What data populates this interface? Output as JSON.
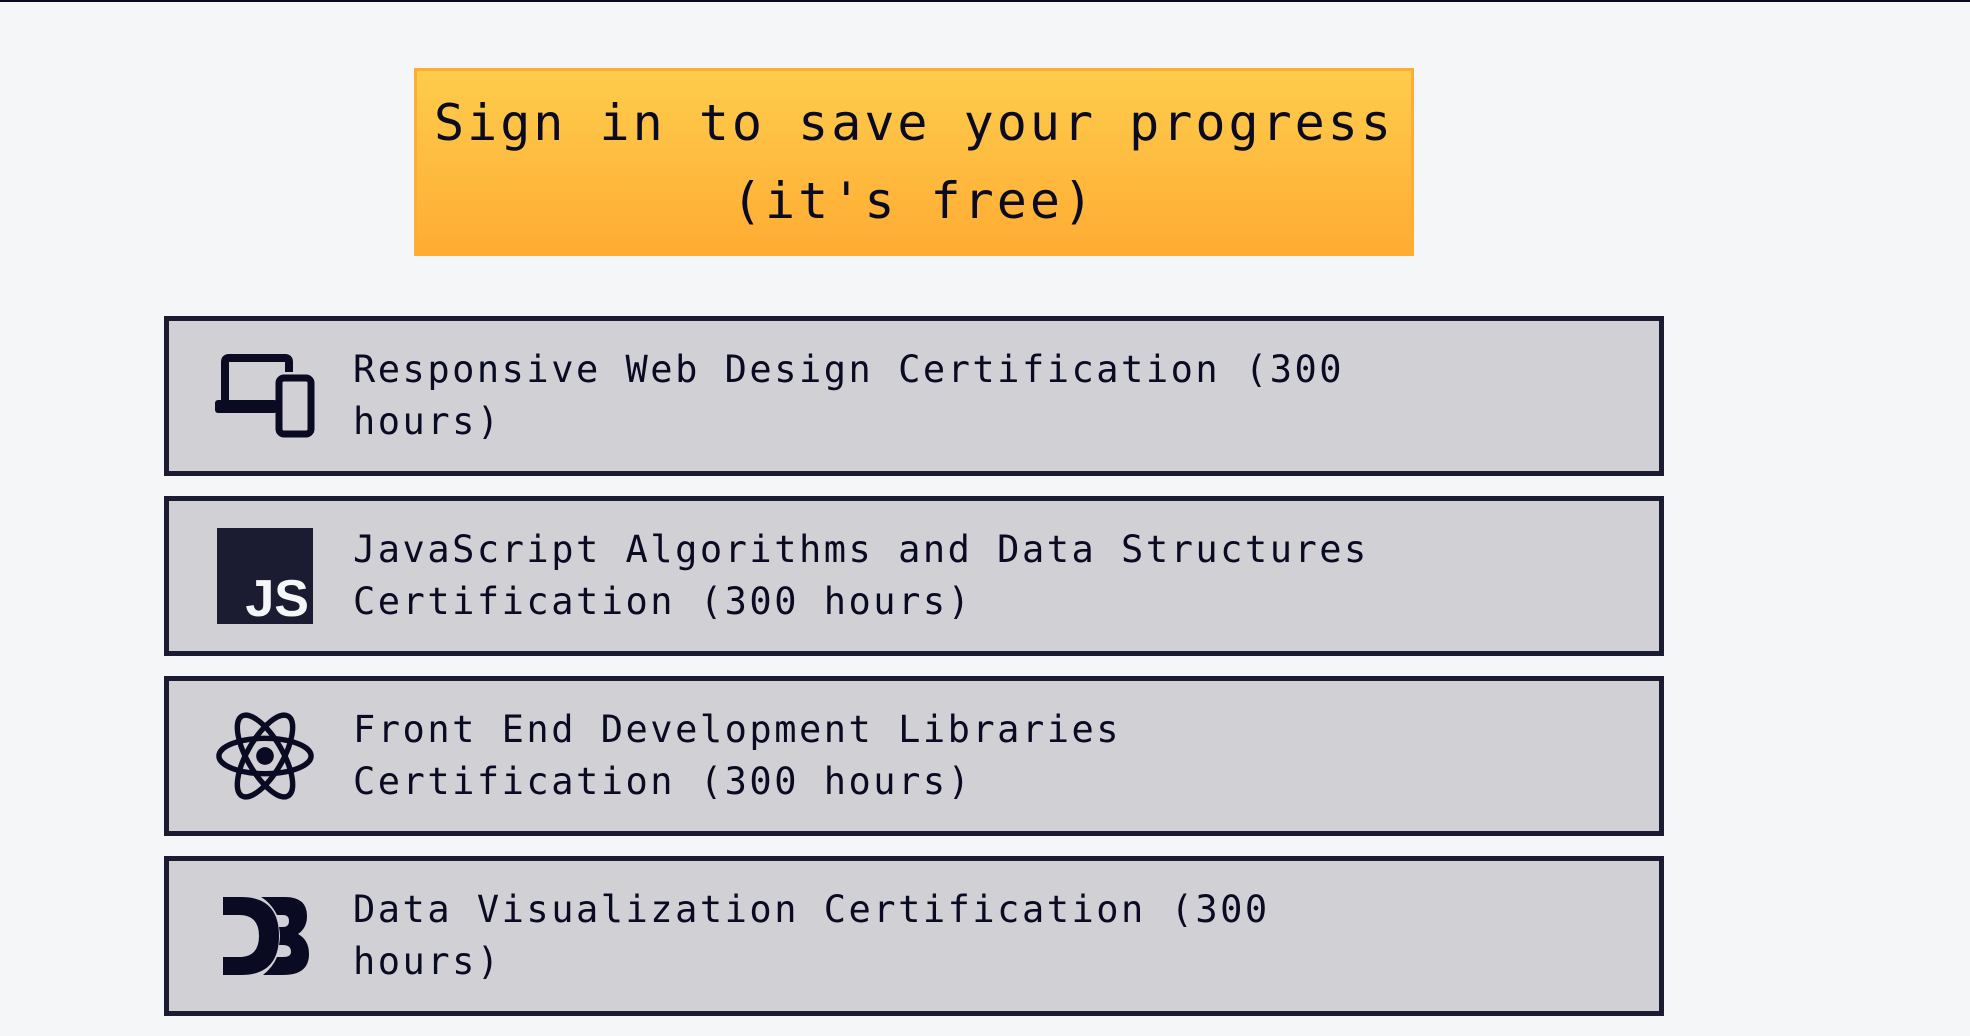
{
  "signin": {
    "label": "Sign in to save your progress\n(it's free)"
  },
  "certifications": [
    {
      "icon": "responsive-devices-icon",
      "label": "Responsive Web Design Certification (300 hours)"
    },
    {
      "icon": "javascript-icon",
      "icon_text": "JS",
      "label": "JavaScript Algorithms and Data Structures Certification (300 hours)"
    },
    {
      "icon": "react-icon",
      "label": "Front End Development Libraries Certification (300 hours)"
    },
    {
      "icon": "d3-icon",
      "label": "Data Visualization Certification (300 hours)"
    }
  ],
  "colors": {
    "page_background": "#f5f6f7",
    "signin_gradient_top": "#fecc4c",
    "signin_gradient_bottom": "#ffac33",
    "card_background": "#d0d0d5",
    "card_border": "#1b1b32",
    "text": "#0a0a23"
  }
}
